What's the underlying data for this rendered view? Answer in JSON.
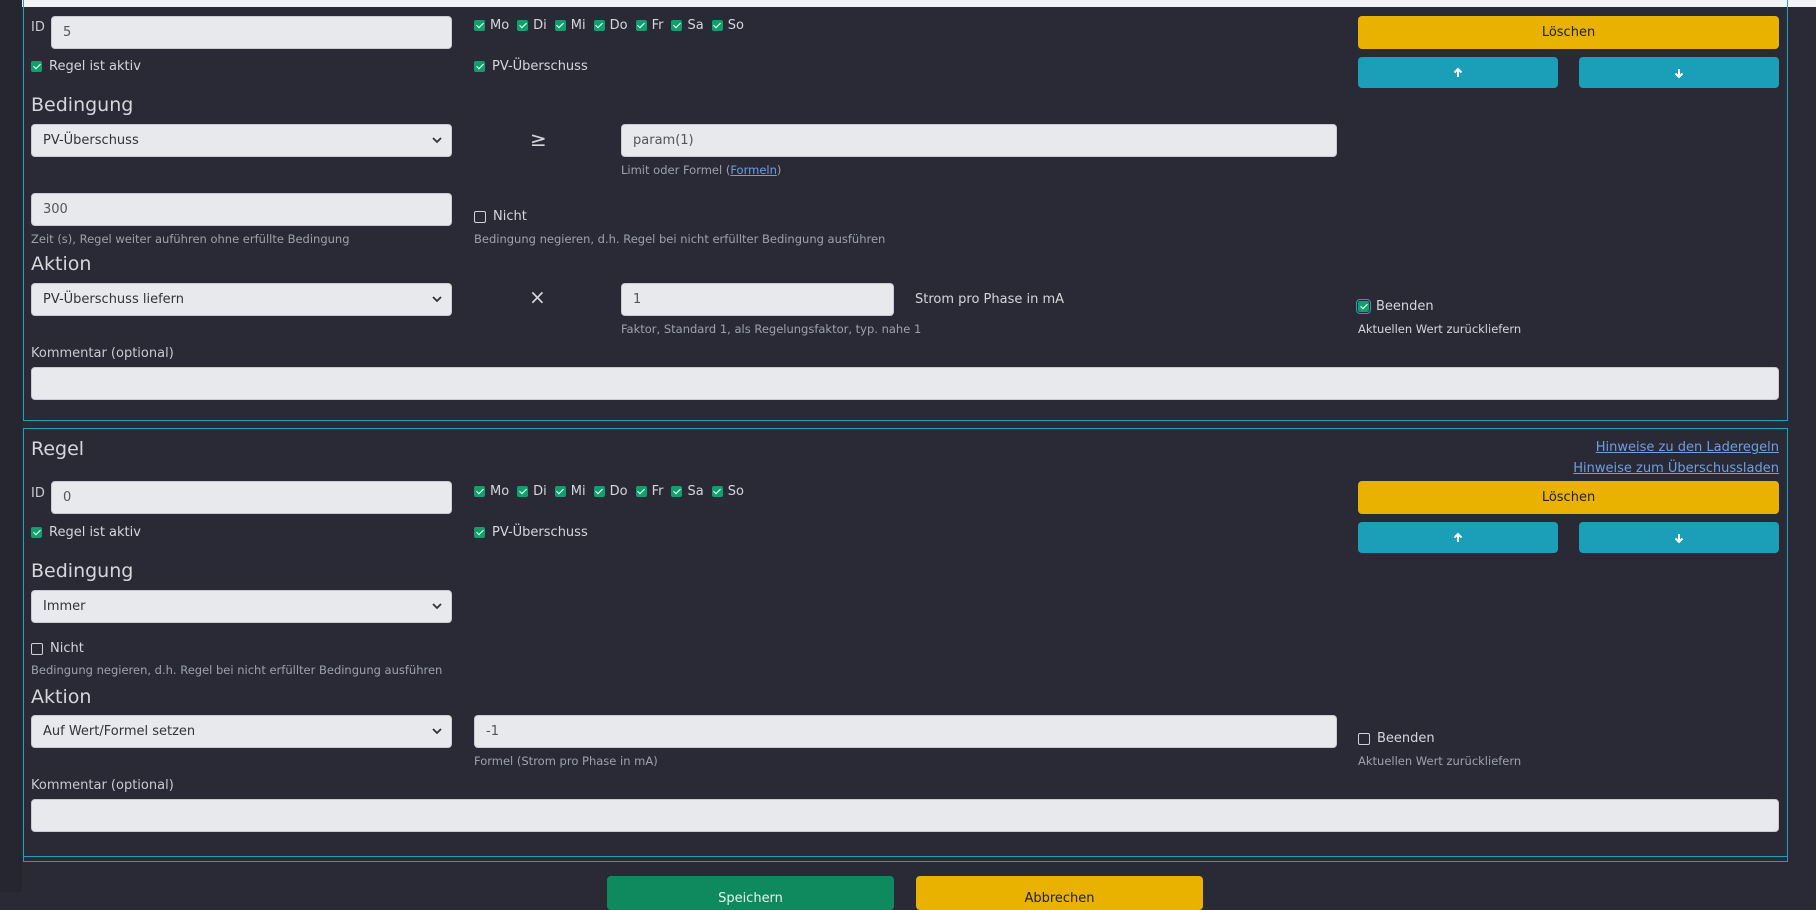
{
  "rules": [
    {
      "title": "",
      "id_label": "ID",
      "id_value": "5",
      "days": [
        {
          "label": "Mo",
          "checked": true
        },
        {
          "label": "Di",
          "checked": true
        },
        {
          "label": "Mi",
          "checked": true
        },
        {
          "label": "Do",
          "checked": true
        },
        {
          "label": "Fr",
          "checked": true
        },
        {
          "label": "Sa",
          "checked": true
        },
        {
          "label": "So",
          "checked": true
        }
      ],
      "active_label": "Regel ist aktiv",
      "pv_label": "PV-Überschuss",
      "delete_label": "Löschen",
      "condition_heading": "Bedingung",
      "condition_select": "PV-Überschuss",
      "condition_operator": "≥",
      "condition_limit": "param(1)",
      "limit_help_prefix": "Limit oder Formel (",
      "limit_help_link": "Formeln",
      "limit_help_suffix": ")",
      "time_value": "300",
      "time_help": "Zeit (s), Regel weiter auführen ohne erfüllte Bedingung",
      "not_label": "Nicht",
      "not_help": "Bedingung negieren, d.h. Regel bei nicht erfüllter Bedingung ausführen",
      "action_heading": "Aktion",
      "action_select": "PV-Überschuss liefern",
      "action_operator": "×",
      "action_value": "1",
      "action_help": "Faktor, Standard 1, als Regelungsfaktor, typ. nahe 1",
      "action_unit": "Strom pro Phase in mA",
      "end_label": "Beenden",
      "end_help": "Aktuellen Wert zurückliefern",
      "comment_label": "Kommentar (optional)",
      "comment_value": ""
    },
    {
      "title": "Regel",
      "link1": "Hinweise zu den Laderegeln",
      "link2": "Hinweise zum Überschussladen",
      "id_label": "ID",
      "id_value": "0",
      "days": [
        {
          "label": "Mo",
          "checked": true
        },
        {
          "label": "Di",
          "checked": true
        },
        {
          "label": "Mi",
          "checked": true
        },
        {
          "label": "Do",
          "checked": true
        },
        {
          "label": "Fr",
          "checked": true
        },
        {
          "label": "Sa",
          "checked": true
        },
        {
          "label": "So",
          "checked": true
        }
      ],
      "active_label": "Regel ist aktiv",
      "pv_label": "PV-Überschuss",
      "delete_label": "Löschen",
      "condition_heading": "Bedingung",
      "condition_select": "Immer",
      "not_label": "Nicht",
      "not_help": "Bedingung negieren, d.h. Regel bei nicht erfüllter Bedingung ausführen",
      "action_heading": "Aktion",
      "action_select": "Auf Wert/Formel setzen",
      "action_value": "-1",
      "action_help": "Formel (Strom pro Phase in mA)",
      "end_label": "Beenden",
      "end_help": "Aktuellen Wert zurückliefern",
      "comment_label": "Kommentar (optional)",
      "comment_value": ""
    }
  ],
  "footer": {
    "save_label": "Speichern",
    "cancel_label": "Abbrechen"
  },
  "colors": {
    "background": "#2a2a36",
    "border": "#1fa1b8",
    "delete": "#e9b100",
    "move": "#1b9fb9",
    "save": "#0f8a5f",
    "check": "#11a06d"
  },
  "icons": [
    "chevron-down-icon",
    "arrow-up-icon",
    "arrow-down-icon"
  ]
}
